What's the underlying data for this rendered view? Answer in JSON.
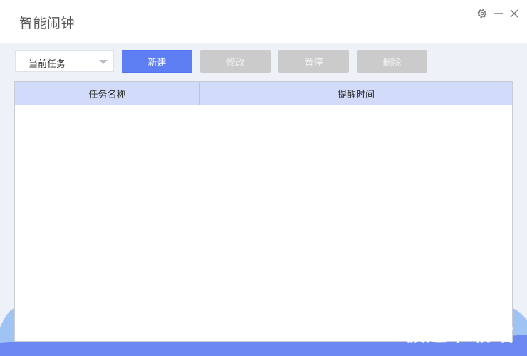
{
  "app": {
    "title": "智能闹钟"
  },
  "toolbar": {
    "task_filter": "当前任务",
    "new_label": "新建",
    "edit_label": "修改",
    "pause_label": "暂停",
    "delete_label": "删除"
  },
  "table": {
    "columns": [
      "任务名称",
      "提醒时间"
    ],
    "rows": []
  },
  "watermark": "极速下载站",
  "colors": {
    "primary": "#5e7ff3",
    "disabled": "#cbcbcb",
    "header": "#d3dbfb",
    "bottom_wave": "#6b89f0"
  }
}
